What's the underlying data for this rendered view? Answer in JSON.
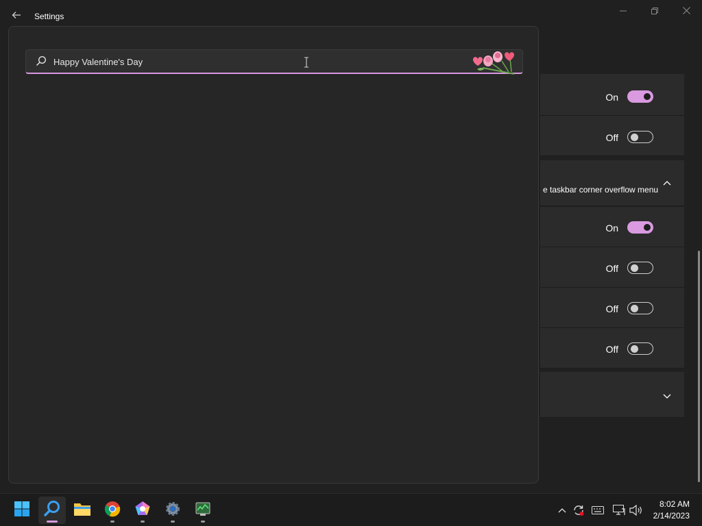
{
  "window": {
    "title": "Settings",
    "back_icon": "arrow-left-icon",
    "controls": [
      "minimize-icon",
      "maximize-icon",
      "close-icon"
    ]
  },
  "search": {
    "value": "Happy Valentine's Day",
    "placeholder": "",
    "search_icon": "search-icon",
    "decoration_icon": "valentine-flowers-icon"
  },
  "settings_rows": [
    {
      "state": "On"
    },
    {
      "state": "Off"
    },
    {
      "expander_text": "e taskbar corner overflow menu",
      "chevron": "chevron-up-icon"
    },
    {
      "state": "On"
    },
    {
      "state": "Off"
    },
    {
      "state": "Off"
    },
    {
      "state": "Off"
    },
    {
      "chevron": "chevron-down-icon"
    }
  ],
  "colors": {
    "accent": "#d99ae0",
    "background": "#202020",
    "panel": "#262626",
    "card": "#2b2b2b",
    "taskbar": "#1c1c1c"
  },
  "taskbar": {
    "apps": [
      "windows-start-icon",
      "search-app-icon",
      "file-explorer-icon",
      "chrome-icon",
      "copilot-app-icon",
      "settings-gear-icon",
      "task-manager-icon"
    ],
    "tray_icons": [
      "chevron-up-icon",
      "sync-icon",
      "keyboard-icon",
      "network-icon",
      "volume-icon"
    ],
    "time": "8:02 AM",
    "date": "2/14/2023"
  }
}
